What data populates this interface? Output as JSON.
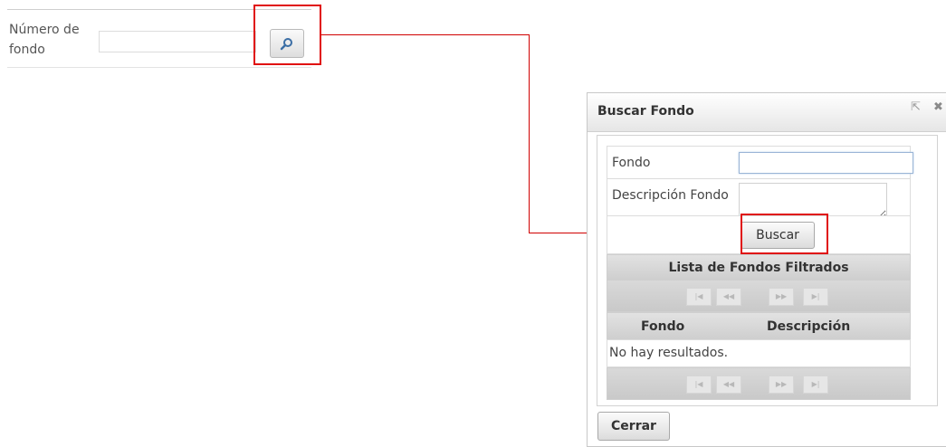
{
  "form": {
    "numero_label": "Número de fondo",
    "numero_value": ""
  },
  "dialog": {
    "title": "Buscar Fondo",
    "fondo_label": "Fondo",
    "fondo_value": "",
    "descripcion_label": "Descripción Fondo",
    "descripcion_value": "",
    "buscar_label": "Buscar",
    "list_title": "Lista de Fondos Filtrados",
    "pager": {
      "first": "|◀",
      "prev": "◀◀",
      "next": "▶▶",
      "last": "▶|"
    },
    "columns": [
      "Fondo",
      "Descripción"
    ],
    "empty_message": "No hay resultados.",
    "cerrar_label": "Cerrar"
  },
  "icons": {
    "search": "magnifier-icon",
    "popout": "popout-icon",
    "close": "close-icon"
  },
  "colors": {
    "highlight": "#e01010",
    "connector": "#d00000",
    "search_icon": "#3b6ea5"
  }
}
